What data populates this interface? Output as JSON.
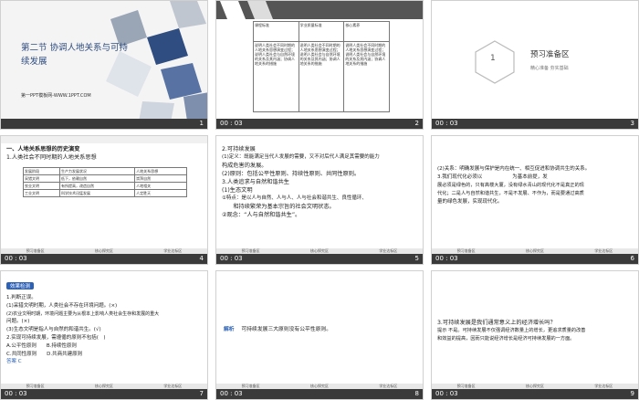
{
  "slides": [
    {
      "num": "1",
      "time": "",
      "title_line1": "第二节  协调人地关系与可持",
      "title_line2": "续发展",
      "subtitle": "第一PPT模板网-WWW.1PPT.COM"
    },
    {
      "num": "2",
      "time": "00 : 03",
      "table_headers": [
        "课程标准",
        "学业质量标准",
        "核心素养"
      ],
      "table_text": "说明人类社会不同时期的人地关系思想演变过程；说明人类社会与自然环境的关系及其内涵；协调人地关系的措施"
    },
    {
      "num": "3",
      "time": "00 : 03",
      "badge": "1",
      "heading": "预习准备区",
      "subheading": "精心准备  夯实基础"
    },
    {
      "num": "4",
      "time": "00 : 03",
      "heading": "一、人地关系思想的历史演变",
      "line1": "1.人类社会不同时期的人地关系思想",
      "table_rows": [
        [
          "发展阶段",
          "生产力发展状况",
          "人地关系思想"
        ],
        [
          "采猎文明",
          "低下，依赖自然",
          "崇拜自然"
        ],
        [
          "农业文明",
          "有所提高，改造自然",
          "人地相关"
        ],
        [
          "工业文明",
          "科学技术迅猛发展",
          "人定胜天"
        ]
      ]
    },
    {
      "num": "5",
      "time": "00 : 03",
      "lines": [
        "2.可持续发展",
        "(1)定义：既能满足当代人发展的需要，又不对后代人满足其需要的能力",
        "构成危害的发展。",
        "(2)原则：包括公平性原则、持续性原则、共同性原则。",
        "3.人类追求与自然和谐共生",
        "(1)生态文明",
        "①特点：是以人与自然、人与人、人与社会和谐共生、良性循环、",
        "　　和持续繁荣为基本宗旨的社会文明状态。",
        "②观念：“人与自然和谐共生”。"
      ]
    },
    {
      "num": "6",
      "time": "00 : 03",
      "lines": [
        "(2)关系：明确发展与保护是内在统一、相互促进和协调共生的关系。",
        "3.我们现代化必须以　　　　　　为基本前提，发",
        "展必须是绿色的，只有高楼大厦，没有绿水青山的现代化不是真正的现",
        "代化；二是人与自然和谐共生，不是不发展、不作为，而是要通过高质",
        "量的绿色发展，实现现代化。"
      ]
    },
    {
      "num": "7",
      "time": "00 : 03",
      "tag": "效果检测",
      "lines": [
        "1.判断正误。",
        "(1)采猎文明时期，人类社会不存在环境问题。(×)",
        "(2)农业文明时期，环境问题主要为从根本上影响人类社会生存和发展的重大",
        "问题。(×)",
        "(3)生态文明是指人与自然的和谐共生。(√)",
        "2.实现可持续发展，需遵循的原则不包括(　)",
        "A.公平性原则　　B.持续性原则",
        "C.共同性原则　　D.共商共建原则",
        "答案  C"
      ]
    },
    {
      "num": "8",
      "time": "00 : 03",
      "label": "解析",
      "text": "可持续发展三大原则没有公平性原则。"
    },
    {
      "num": "9",
      "time": "00 : 03",
      "lines": [
        "3.可持续发展是我们通常意义上的经济增长吗？",
        "提示  不是。可持续发展不仅强调经济数量上的增长，更追求质量的改善",
        "和效益的提高，因而只能说经济增长是经济可持续发展的一方面。"
      ]
    }
  ],
  "bar_labels": [
    "预习准备区",
    "核心探究区",
    "学业达标区"
  ]
}
